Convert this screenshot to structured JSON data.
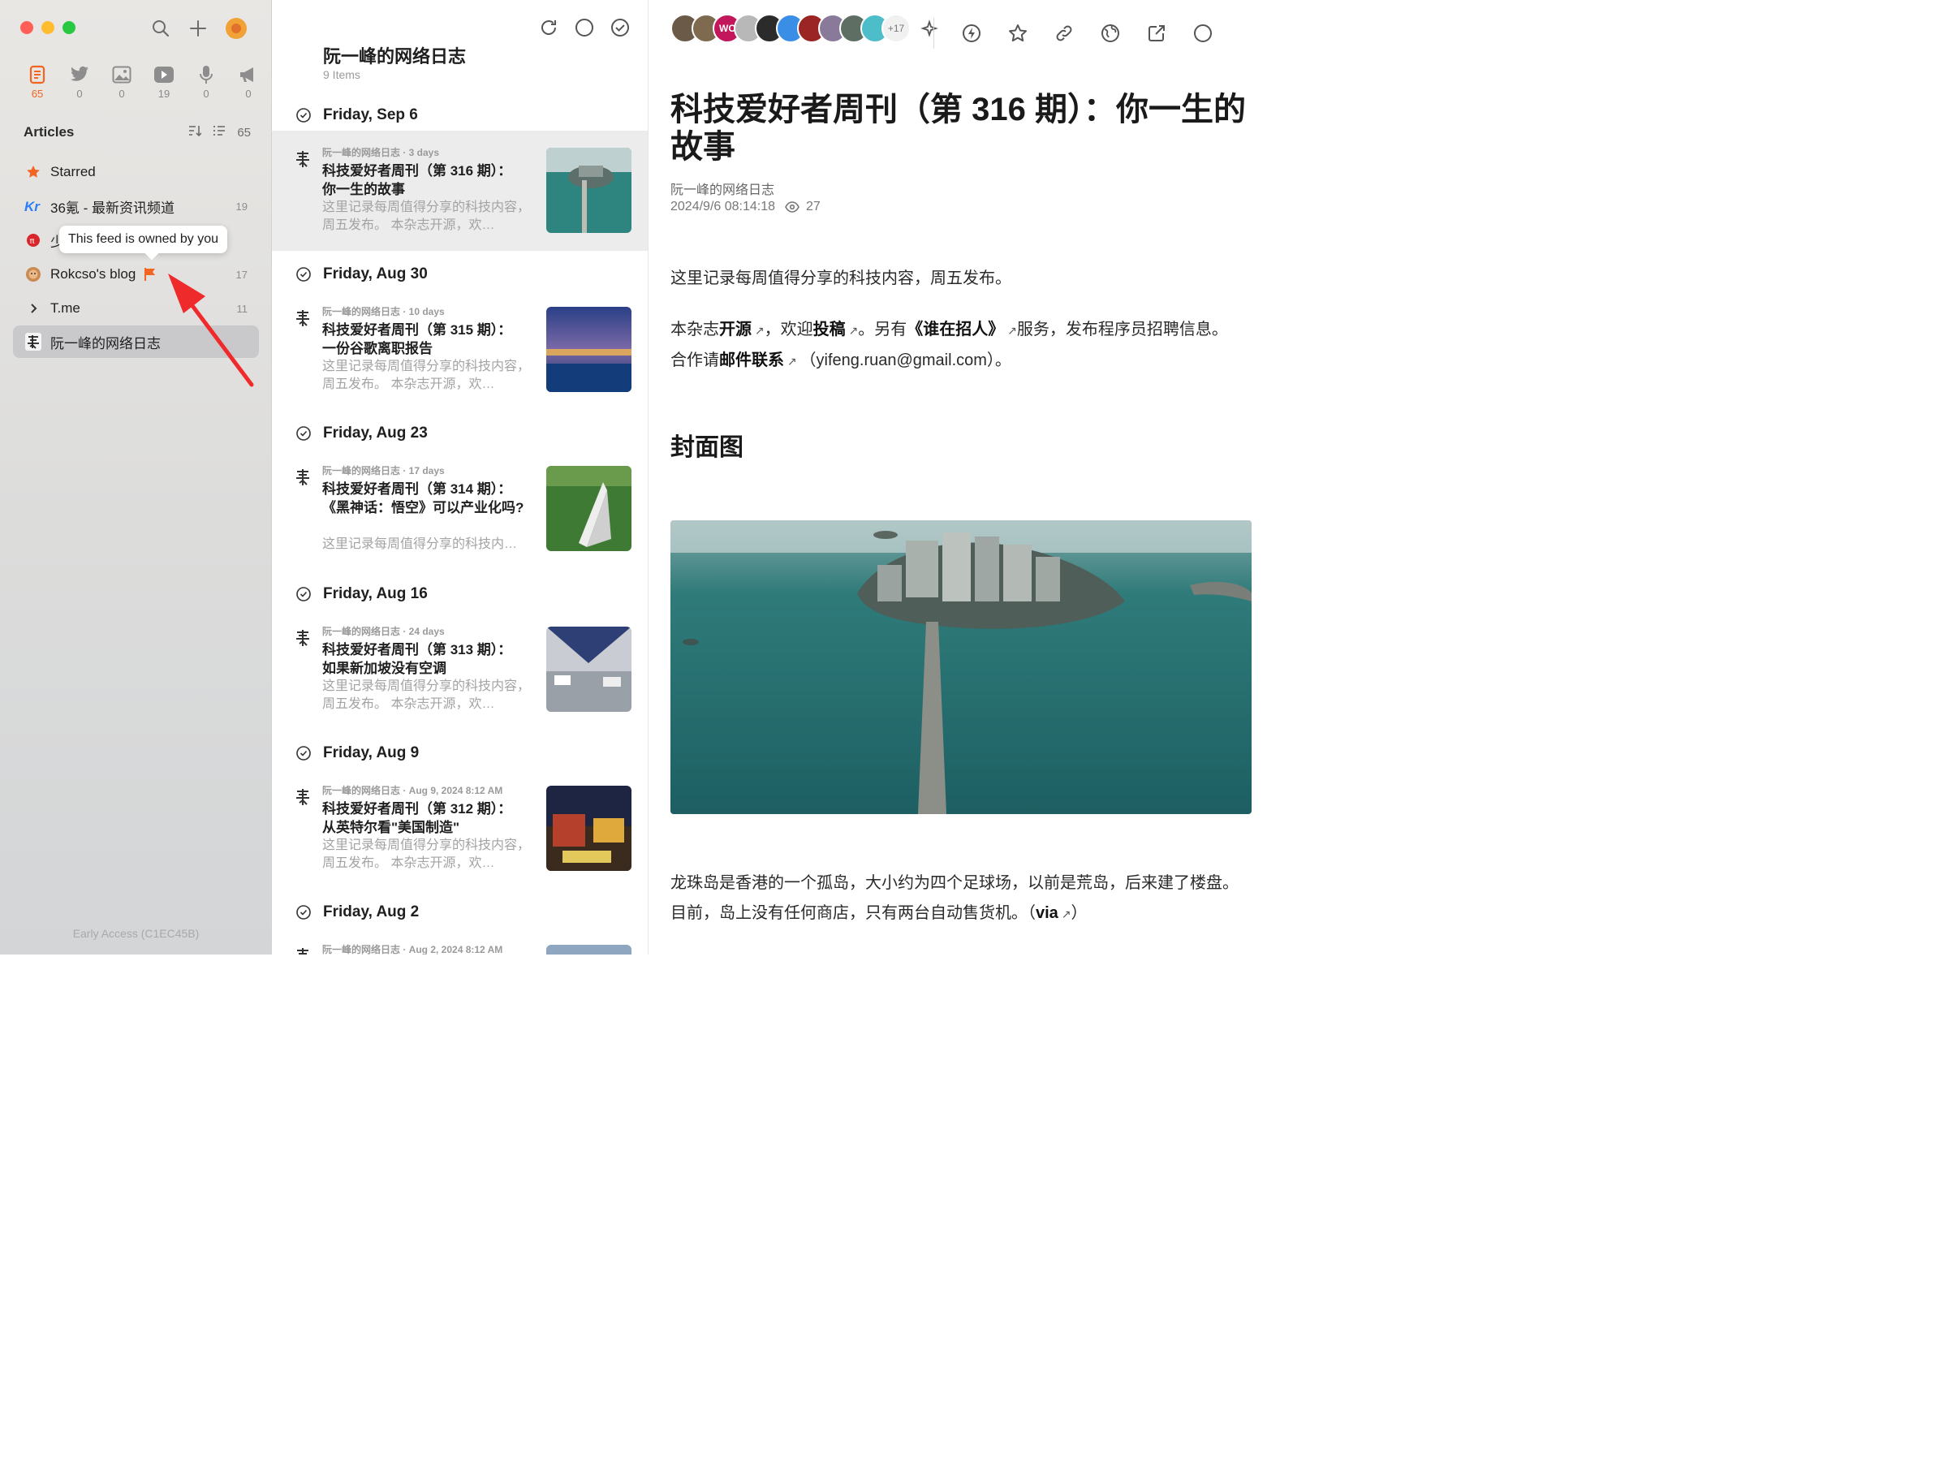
{
  "sidebar": {
    "views": [
      {
        "icon": "article-icon",
        "count": "65",
        "active": true
      },
      {
        "icon": "twitter-icon",
        "count": "0"
      },
      {
        "icon": "picture-icon",
        "count": "0"
      },
      {
        "icon": "video-icon",
        "count": "19"
      },
      {
        "icon": "microphone-icon",
        "count": "0"
      },
      {
        "icon": "megaphone-icon",
        "count": "0"
      }
    ],
    "section_title": "Articles",
    "section_count": "65",
    "feeds": [
      {
        "label": "Starred",
        "count": ""
      },
      {
        "label": "36氪 - 最新资讯频道",
        "count": "19"
      },
      {
        "label": "少",
        "count": ""
      },
      {
        "label": "Rokcso's blog",
        "count": "17"
      },
      {
        "label": "T.me",
        "count": "11"
      },
      {
        "label": "阮一峰的网络日志",
        "count": ""
      }
    ],
    "tooltip": "This feed is owned by you",
    "footer": "Early Access (C1EC45B)"
  },
  "list": {
    "title": "阮一峰的网络日志",
    "subtitle": "9 Items",
    "groups": [
      {
        "day": "Friday, Sep 6",
        "meta": "阮一峰的网络日志 · 3 days",
        "title": "科技爱好者周刊（第 316 期）：你一生的故事",
        "desc": "这里记录每周值得分享的科技内容，周五发布。 本杂志开源，欢…"
      },
      {
        "day": "Friday, Aug 30",
        "meta": "阮一峰的网络日志 · 10 days",
        "title": "科技爱好者周刊（第 315 期）：一份谷歌离职报告",
        "desc": "这里记录每周值得分享的科技内容，周五发布。 本杂志开源，欢…"
      },
      {
        "day": "Friday, Aug 23",
        "meta": "阮一峰的网络日志 · 17 days",
        "title": "科技爱好者周刊（第 314 期）：《黑神话：悟空》可以产业化吗?",
        "desc": "这里记录每周值得分享的科技内…"
      },
      {
        "day": "Friday, Aug 16",
        "meta": "阮一峰的网络日志 · 24 days",
        "title": "科技爱好者周刊（第 313 期）：如果新加坡没有空调",
        "desc": "这里记录每周值得分享的科技内容，周五发布。 本杂志开源，欢…"
      },
      {
        "day": "Friday, Aug 9",
        "meta": "阮一峰的网络日志 · Aug 9, 2024 8:12 AM",
        "title": "科技爱好者周刊（第 312 期）：从英特尔看\"美国制造\"",
        "desc": "这里记录每周值得分享的科技内容，周五发布。 本杂志开源，欢…"
      },
      {
        "day": "Friday, Aug 2",
        "meta": "阮一峰的网络日志 · Aug 2, 2024 8:12 AM",
        "title": "",
        "desc": ""
      }
    ]
  },
  "reader": {
    "avatar_more": "+17",
    "avatar_wc": "WC",
    "title": "科技爱好者周刊（第 316 期）：你一生的故事",
    "feed": "阮一峰的网络日志",
    "date": "2024/9/6 08:14:18",
    "views": "27",
    "p1": "这里记录每周值得分享的科技内容，周五发布。",
    "p2": {
      "a": "本杂志",
      "b": "开源",
      "c": "，欢迎",
      "d": "投稿",
      "e": "。另有",
      "f": "《谁在招人》",
      "g": "服务，发布程序员招聘信息。合作请",
      "h": "邮件联系",
      "i": "（yifeng.ruan@gmail.com）。"
    },
    "h2": "封面图",
    "p3": {
      "a": "龙珠岛是香港的一个孤岛，大小约为四个足球场，以前是荒岛，后来建了楼盘。目前，岛上没有任何商店，只有两台自动售货机。（",
      "b": "via",
      "c": "）"
    }
  },
  "colors": {
    "accent": "#f26522",
    "selected_row": "#ececec",
    "sidebar_selected": "#c9c9cc"
  }
}
